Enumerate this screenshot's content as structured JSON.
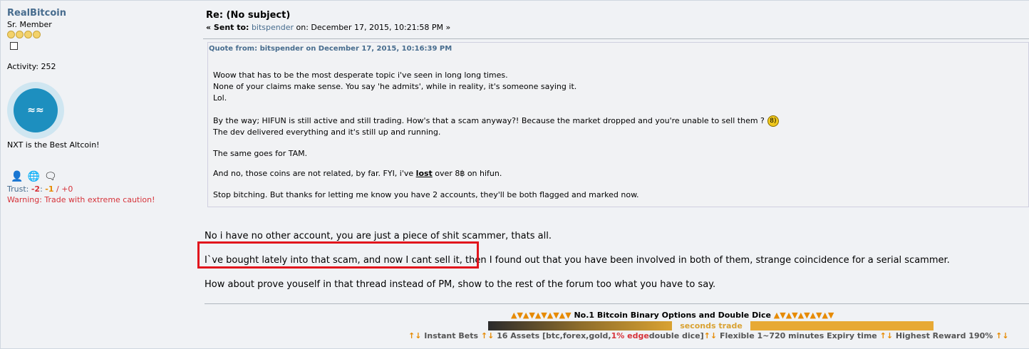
{
  "poster": {
    "username": "RealBitcoin",
    "rank": "Sr. Member",
    "activity": "Activity: 252",
    "personal_text": "NXT is the Best Altcoin!",
    "trust_label": "Trust: ",
    "trust_a": "-2",
    "trust_b": "-1",
    "trust_c": "/ +0",
    "warning": "Warning: Trade with extreme caution!"
  },
  "post": {
    "subject": "Re: (No subject)",
    "sent_prefix": "« Sent to:",
    "sent_to": "bitspender",
    "sent_on": "on: December 17, 2015, 10:21:58 PM »",
    "quote_header": "Quote from: bitspender on December 17, 2015, 10:16:39 PM",
    "quote_lines": [
      "Woow that has to be the most desperate topic i've seen in long long times.",
      "None of your claims make sense. You say 'he admits', while in reality, it's someone saying it.",
      "Lol.",
      "",
      "By the way; HIFUN is still active and still trading. How's that a scam anyway?! Because the market dropped and you're unable to sell them ?",
      "The dev delivered everything and it's still up and running.",
      "",
      "The same goes for TAM.",
      "",
      "And no, those coins are not related, by far. FYI, i've lost over 8฿ on hifun.",
      "",
      "Stop bitching. But thanks for letting me know you have 2 accounts, they'll be both flagged and marked now."
    ],
    "body_lines": [
      "No i have no other account, you are just a piece of shit scammer, thats all.",
      "I`ve bought lately into that scam, and now I cant sell it, then I found out that you have been involved in both of them, strange coincidence for a serial scammer.",
      "How about prove youself in that thread instead of PM, show to the rest of the forum too what you have to say."
    ]
  },
  "signature": {
    "line1_left": "▲▼▲▼▲▼▲▼▲▼",
    "line1_title": "No.1 Bitcoin Binary Options and Double Dice",
    "line1_right": "▲▼▲▼▲▼▲▼▲▼",
    "line2": "seconds trade",
    "line3_a": "Instant Bets",
    "line3_b": "16 Assets [btc,forex,gold,",
    "line3_c": "1% edge",
    "line3_d": "double dice]",
    "line3_e": "Flexible 1~720 minutes Expiry time",
    "line3_f": "Highest Reward 190%",
    "arrow": "↑↓"
  },
  "colors": {
    "link": "#476c8e",
    "warning": "#d6333a",
    "highlight_box": "#e1161d",
    "accent_gold": "#e7a935"
  }
}
